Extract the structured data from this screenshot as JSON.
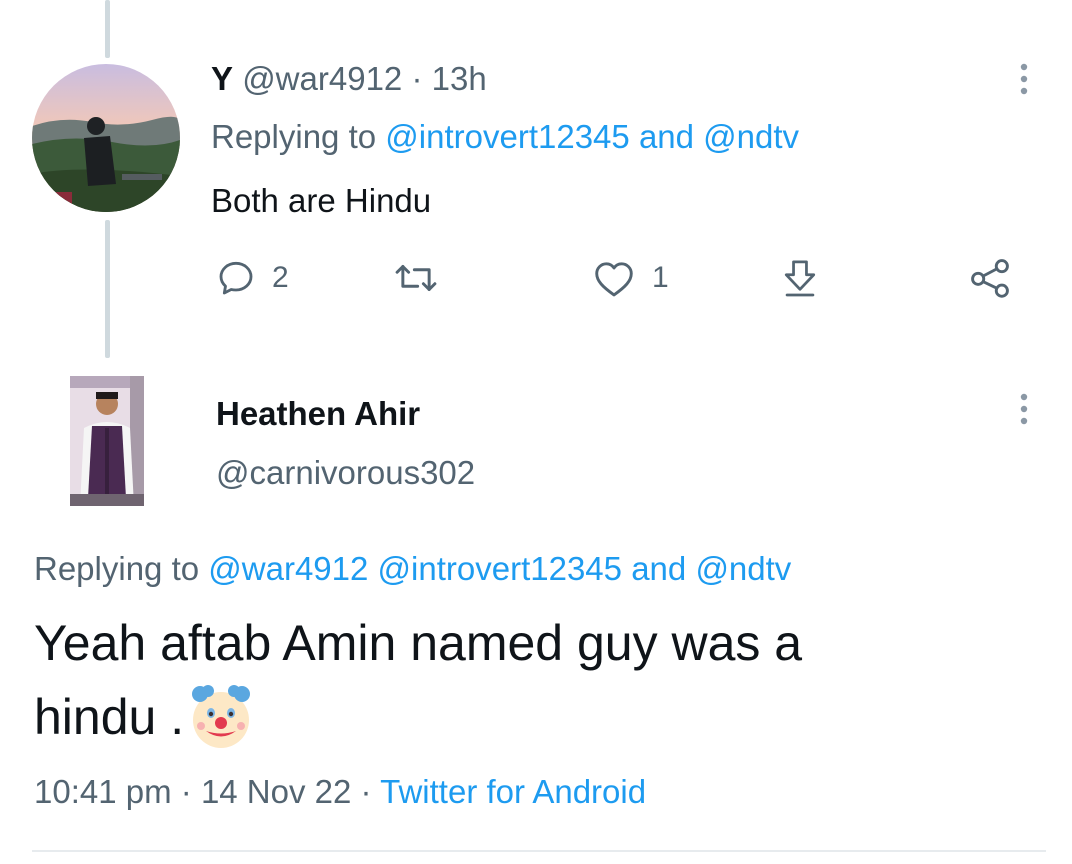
{
  "parent_tweet": {
    "display_name": "Y",
    "handle": "@war4912",
    "separator": "·",
    "time": "13h",
    "replying_prefix": "Replying to",
    "replying_to": [
      "@introvert12345",
      "@ndtv"
    ],
    "replying_conj": "and",
    "text": "Both are Hindu",
    "actions": {
      "reply_count": "2",
      "retweet_count": "",
      "like_count": "1"
    }
  },
  "main_tweet": {
    "display_name": "Heathen Ahir",
    "handle": "@carnivorous302",
    "replying_prefix": "Replying to",
    "replying_to": [
      "@war4912",
      "@introvert12345",
      "@ndtv"
    ],
    "replying_conj": "and",
    "text_line1": "Yeah aftab Amin named guy was a",
    "text_line2": "hindu .",
    "emoji": "clown-face",
    "timestamp_time": "10:41 pm",
    "separator": "·",
    "timestamp_date": "14 Nov 22",
    "source": "Twitter for Android"
  },
  "colors": {
    "link": "#1d9bf0",
    "muted": "#536471",
    "text": "#0f1419",
    "thread_line": "#cfd9de"
  },
  "icons": [
    "more-icon",
    "reply-icon",
    "retweet-icon",
    "like-icon",
    "download-icon",
    "share-icon",
    "clown-emoji"
  ]
}
